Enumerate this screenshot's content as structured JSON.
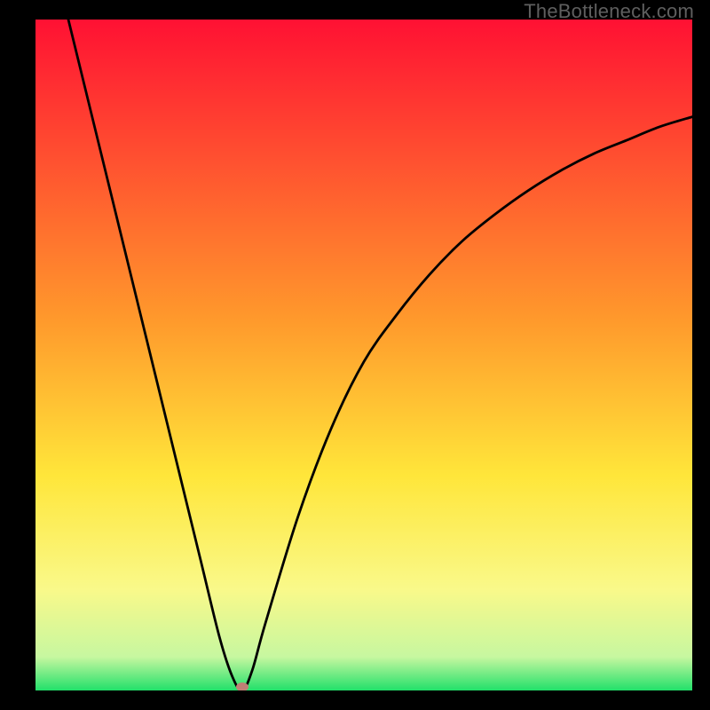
{
  "attribution": "TheBottleneck.com",
  "colors": {
    "frame": "#000000",
    "top": "#ff1133",
    "mid_upper": "#ff7a2c",
    "mid": "#ffd83a",
    "mid_lower": "#f9f98a",
    "green": "#22e06a",
    "marker": "#bf8075",
    "curve": "#000000"
  },
  "chart_data": {
    "type": "line",
    "title": "",
    "xlabel": "",
    "ylabel": "",
    "xlim": [
      0,
      100
    ],
    "ylim": [
      0,
      100
    ],
    "series": [
      {
        "name": "bottleneck-curve",
        "x": [
          5,
          10,
          15,
          20,
          25,
          28,
          30,
          31.5,
          33,
          35,
          40,
          45,
          50,
          55,
          60,
          65,
          70,
          75,
          80,
          85,
          90,
          95,
          100
        ],
        "y": [
          100,
          80,
          60,
          40,
          20,
          8,
          2,
          0,
          3,
          10,
          26,
          39,
          49,
          56,
          62,
          67,
          71,
          74.5,
          77.5,
          80,
          82,
          84,
          85.5
        ]
      }
    ],
    "optimal_point": {
      "x": 31.5,
      "y": 0
    },
    "gradient_stops": [
      {
        "offset": 0,
        "color": "#ff1133"
      },
      {
        "offset": 45,
        "color": "#ff9a2c"
      },
      {
        "offset": 68,
        "color": "#ffe63a"
      },
      {
        "offset": 85,
        "color": "#f9f98a"
      },
      {
        "offset": 95,
        "color": "#c7f7a0"
      },
      {
        "offset": 100,
        "color": "#22e06a"
      }
    ]
  }
}
